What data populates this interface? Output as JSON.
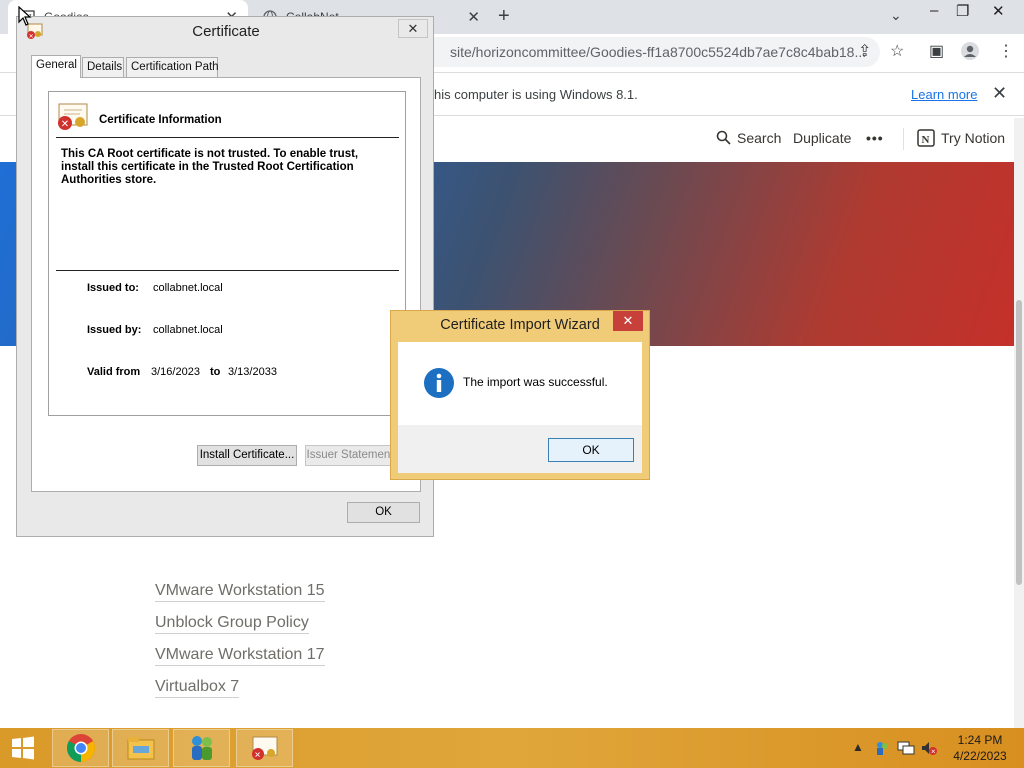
{
  "browser": {
    "tabs": [
      {
        "label": "Goodies",
        "close": "✕"
      },
      {
        "label": "CollabNet",
        "close": "✕"
      }
    ],
    "new_tab": "+",
    "url": "site/horizoncommittee/Goodies-ff1a8700c5524db7ae7c8c4bab18...",
    "infobar": {
      "message": "his computer is using Windows 8.1.",
      "learn_more": "Learn more",
      "close": "✕"
    }
  },
  "notion": {
    "search": "Search",
    "duplicate": "Duplicate",
    "more": "•••",
    "try_notion": "Try Notion",
    "links": [
      "VMware Workstation 15",
      "Unblock Group Policy",
      "VMware Workstation 17",
      "Virtualbox 7"
    ]
  },
  "certificate": {
    "title": "Certificate",
    "close": "✕",
    "tabs": [
      "General",
      "Details",
      "Certification Path"
    ],
    "info_heading": "Certificate Information",
    "warning": "This CA Root certificate is not trusted. To enable trust, install this certificate in the Trusted Root Certification Authorities store.",
    "issued_to_label": "Issued to:",
    "issued_to": "collabnet.local",
    "issued_by_label": "Issued by:",
    "issued_by": "collabnet.local",
    "valid_from_label": "Valid from",
    "valid_from": "3/16/2023",
    "valid_to_label": "to",
    "valid_to": "3/13/2033",
    "install_button": "Install Certificate...",
    "issuer_button": "Issuer Statement",
    "ok_button": "OK"
  },
  "wizard": {
    "title": "Certificate Import Wizard",
    "close": "✕",
    "message": "The import was successful.",
    "ok_button": "OK"
  },
  "taskbar": {
    "time": "1:24 PM",
    "date": "4/22/2023"
  },
  "colors": {
    "accent_blue": "#1a73e8",
    "wizard_frame": "#f1cc78",
    "close_red": "#c7403a",
    "taskbar": "#e0a63a"
  }
}
